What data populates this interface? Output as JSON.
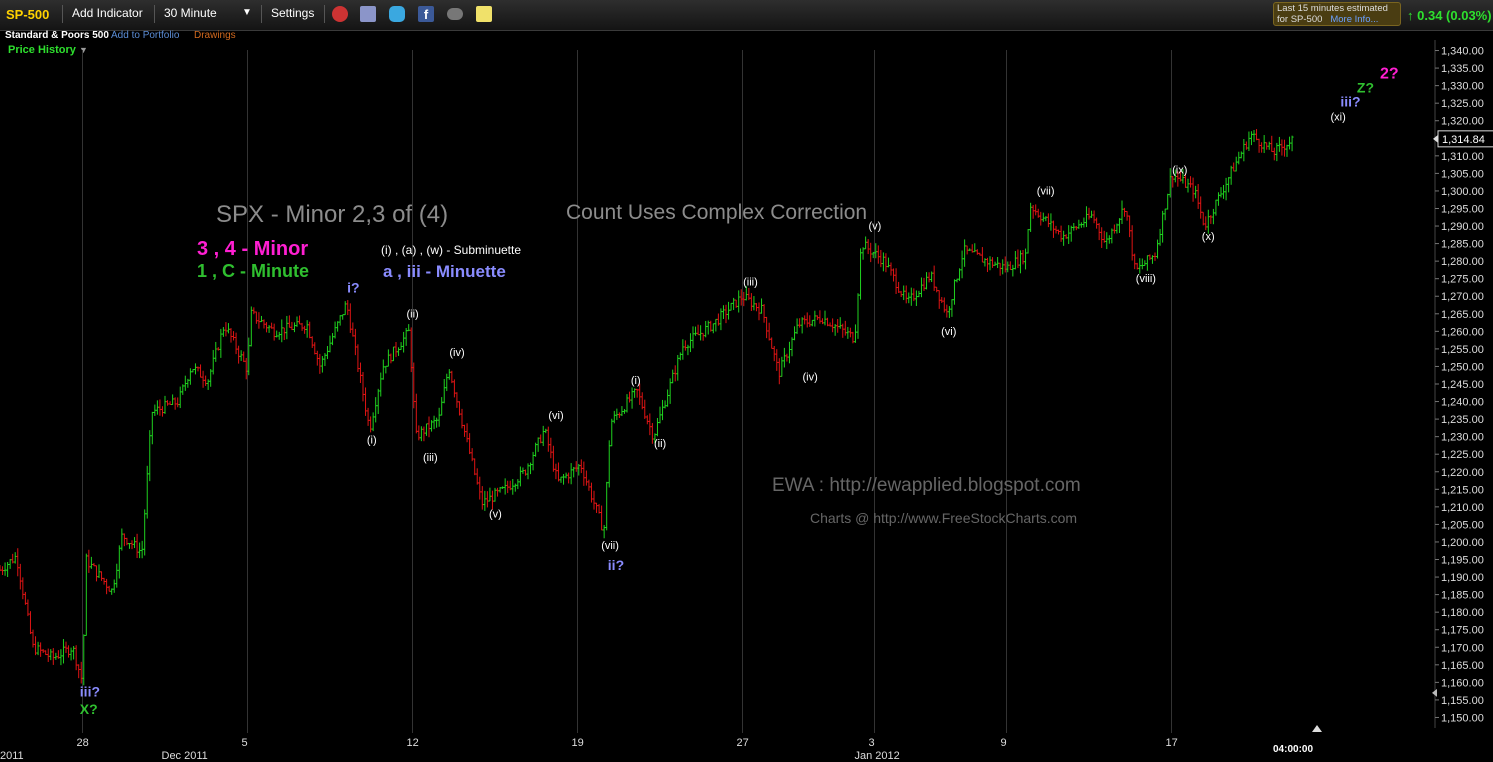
{
  "toolbar": {
    "symbol": "SP-500",
    "add_indicator": "Add Indicator",
    "interval": "30 Minute",
    "settings": "Settings",
    "index_name": "Standard & Poors 500",
    "add_to_portfolio": "Add to Portfolio",
    "drawings": "Drawings",
    "delay_line1": "Last 15 minutes estimated",
    "delay_line2": "for SP-500",
    "more_info": "More Info...",
    "change": "0.34 (0.03%)",
    "price_history": "Price History",
    "icons": [
      "alarm-icon",
      "layers-icon",
      "twitter-icon",
      "facebook-icon",
      "binoculars-icon",
      "note-icon"
    ]
  },
  "chart_data": {
    "type": "candlestick",
    "title": "SPX - Minor 2,3 of (4)",
    "subtitle": "Count Uses Complex Correction",
    "watermark_1": "EWA : http://ewapplied.blogspot.com",
    "watermark_2": "Charts @ http://www.FreeStockCharts.com",
    "legend": [
      {
        "text": "3 , 4 - Minor",
        "color": "#ff1fd2"
      },
      {
        "text": "1 , C - Minute",
        "color": "#2fbf2f"
      },
      {
        "text": "(i) , (a)  , (w) - Subminuette",
        "color": "#ffffff"
      },
      {
        "text": "a , iii - Minuette",
        "color": "#8a8cff"
      }
    ],
    "last_price": "1,314.84",
    "time_label": "04:00:00",
    "ylim": [
      1147,
      1343
    ],
    "y_ticks": [
      1150,
      1155,
      1160,
      1165,
      1170,
      1175,
      1180,
      1185,
      1190,
      1195,
      1200,
      1205,
      1210,
      1215,
      1220,
      1225,
      1230,
      1235,
      1240,
      1245,
      1250,
      1255,
      1260,
      1265,
      1270,
      1275,
      1280,
      1285,
      1290,
      1295,
      1300,
      1305,
      1310,
      1315,
      1320,
      1325,
      1330,
      1335,
      1340
    ],
    "y_tick_labels": [
      "1,150.00",
      "1,155.00",
      "1,160.00",
      "1,165.00",
      "1,170.00",
      "1,175.00",
      "1,180.00",
      "1,185.00",
      "1,190.00",
      "1,195.00",
      "1,200.00",
      "1,205.00",
      "1,210.00",
      "1,215.00",
      "1,220.00",
      "1,225.00",
      "1,230.00",
      "1,235.00",
      "1,240.00",
      "1,245.00",
      "1,250.00",
      "1,255.00",
      "1,260.00",
      "1,265.00",
      "1,270.00",
      "1,275.00",
      "1,280.00",
      "1,285.00",
      "1,290.00",
      "1,295.00",
      "1,300.00",
      "1,305.00",
      "1,310.00",
      "1,315.00",
      "1,320.00",
      "1,325.00",
      "1,330.00",
      "1,335.00",
      "1,340.00"
    ],
    "x_sessions": 40,
    "x_ticks": [
      {
        "label": "2011",
        "s": 0
      },
      {
        "label": "28",
        "s": 2.5
      },
      {
        "label": "Dec 2011",
        "s": 5.5
      },
      {
        "label": "5",
        "s": 7.5
      },
      {
        "label": "12",
        "s": 12.5
      },
      {
        "label": "19",
        "s": 17.5
      },
      {
        "label": "27",
        "s": 22.5
      },
      {
        "label": "3",
        "s": 26.5
      },
      {
        "label": "Jan 2012",
        "s": 26.5
      },
      {
        "label": "9",
        "s": 30.5
      },
      {
        "label": "17",
        "s": 35.5
      }
    ],
    "anchors": [
      [
        0,
        1192
      ],
      [
        0.5,
        1196
      ],
      [
        1,
        1170
      ],
      [
        1.6,
        1167
      ],
      [
        2.2,
        1170
      ],
      [
        2.5,
        1160
      ],
      [
        2.6,
        1195
      ],
      [
        3.4,
        1186
      ],
      [
        3.7,
        1202
      ],
      [
        4.3,
        1197
      ],
      [
        4.6,
        1237
      ],
      [
        5.4,
        1240
      ],
      [
        5.8,
        1250
      ],
      [
        6.3,
        1246
      ],
      [
        6.8,
        1262
      ],
      [
        7.5,
        1249
      ],
      [
        7.6,
        1265
      ],
      [
        8.3,
        1260
      ],
      [
        9.3,
        1262
      ],
      [
        9.7,
        1250
      ],
      [
        10.5,
        1268
      ],
      [
        11.2,
        1232
      ],
      [
        11.6,
        1250
      ],
      [
        12.4,
        1260
      ],
      [
        12.6,
        1230
      ],
      [
        13.3,
        1235
      ],
      [
        13.6,
        1250
      ],
      [
        14.6,
        1211
      ],
      [
        15.3,
        1215
      ],
      [
        15.9,
        1220
      ],
      [
        16.5,
        1232
      ],
      [
        16.9,
        1217
      ],
      [
        17.6,
        1222
      ],
      [
        18.3,
        1203
      ],
      [
        18.5,
        1234
      ],
      [
        19.3,
        1243
      ],
      [
        19.8,
        1230
      ],
      [
        20.7,
        1256
      ],
      [
        21.6,
        1262
      ],
      [
        22.5,
        1270
      ],
      [
        23.1,
        1266
      ],
      [
        23.6,
        1248
      ],
      [
        24.2,
        1262
      ],
      [
        24.9,
        1264
      ],
      [
        25.9,
        1258
      ],
      [
        26.1,
        1285
      ],
      [
        26.8,
        1280
      ],
      [
        27.5,
        1268
      ],
      [
        28.2,
        1276
      ],
      [
        28.7,
        1265
      ],
      [
        29.2,
        1283
      ],
      [
        29.9,
        1280
      ],
      [
        30.5,
        1278
      ],
      [
        31.1,
        1282
      ],
      [
        31.2,
        1296
      ],
      [
        32.2,
        1287
      ],
      [
        33.1,
        1293
      ],
      [
        33.5,
        1285
      ],
      [
        34.1,
        1296
      ],
      [
        34.4,
        1277
      ],
      [
        35,
        1282
      ],
      [
        35.5,
        1305
      ],
      [
        36.2,
        1300
      ],
      [
        36.5,
        1290
      ],
      [
        37.4,
        1307
      ],
      [
        37.9,
        1316
      ],
      [
        38.6,
        1311
      ],
      [
        39.2,
        1314.8
      ]
    ],
    "wave_labels": [
      {
        "text": "iii?",
        "s": 2.6,
        "y": 1156,
        "color": "#8a8cff",
        "size": 14
      },
      {
        "text": "X?",
        "s": 2.6,
        "y": 1151,
        "color": "#2fbf2f",
        "size": 14
      },
      {
        "text": "i?",
        "s": 10.7,
        "y": 1271,
        "color": "#8a8cff",
        "size": 14
      },
      {
        "text": "(i)",
        "s": 11.3,
        "y": 1228,
        "color": "#ffffff",
        "size": 11
      },
      {
        "text": "(ii)",
        "s": 12.5,
        "y": 1264,
        "color": "#ffffff",
        "size": 11
      },
      {
        "text": "(iii)",
        "s": 13.0,
        "y": 1223,
        "color": "#ffffff",
        "size": 11
      },
      {
        "text": "(iv)",
        "s": 13.8,
        "y": 1253,
        "color": "#ffffff",
        "size": 11
      },
      {
        "text": "(v)",
        "s": 15.0,
        "y": 1207,
        "color": "#ffffff",
        "size": 11
      },
      {
        "text": "(vi)",
        "s": 16.8,
        "y": 1235,
        "color": "#ffffff",
        "size": 11
      },
      {
        "text": "(vii)",
        "s": 18.4,
        "y": 1198,
        "color": "#ffffff",
        "size": 11
      },
      {
        "text": "ii?",
        "s": 18.6,
        "y": 1192,
        "color": "#8a8cff",
        "size": 14
      },
      {
        "text": "(i)",
        "s": 19.3,
        "y": 1245,
        "color": "#ffffff",
        "size": 11
      },
      {
        "text": "(ii)",
        "s": 20.0,
        "y": 1227,
        "color": "#ffffff",
        "size": 11
      },
      {
        "text": "(iii)",
        "s": 22.7,
        "y": 1273,
        "color": "#ffffff",
        "size": 11
      },
      {
        "text": "(iv)",
        "s": 24.5,
        "y": 1246,
        "color": "#ffffff",
        "size": 11
      },
      {
        "text": "(v)",
        "s": 26.5,
        "y": 1289,
        "color": "#ffffff",
        "size": 11
      },
      {
        "text": "(vi)",
        "s": 28.7,
        "y": 1259,
        "color": "#ffffff",
        "size": 11
      },
      {
        "text": "(vii)",
        "s": 31.6,
        "y": 1299,
        "color": "#ffffff",
        "size": 11
      },
      {
        "text": "(viii)",
        "s": 34.6,
        "y": 1274,
        "color": "#ffffff",
        "size": 11
      },
      {
        "text": "(ix)",
        "s": 35.7,
        "y": 1305,
        "color": "#ffffff",
        "size": 11
      },
      {
        "text": "(x)",
        "s": 36.6,
        "y": 1286,
        "color": "#ffffff",
        "size": 11
      },
      {
        "text": "(xi)",
        "s": 40.5,
        "y": 1320,
        "color": "#ffffff",
        "size": 11
      },
      {
        "text": "iii?",
        "s": 40.8,
        "y": 1324,
        "color": "#8a8cff",
        "size": 14
      },
      {
        "text": "Z?",
        "s": 41.3,
        "y": 1328,
        "color": "#2fbf2f",
        "size": 14
      },
      {
        "text": "2?",
        "s": 42.0,
        "y": 1332,
        "color": "#ff1fd2",
        "size": 16
      }
    ]
  }
}
